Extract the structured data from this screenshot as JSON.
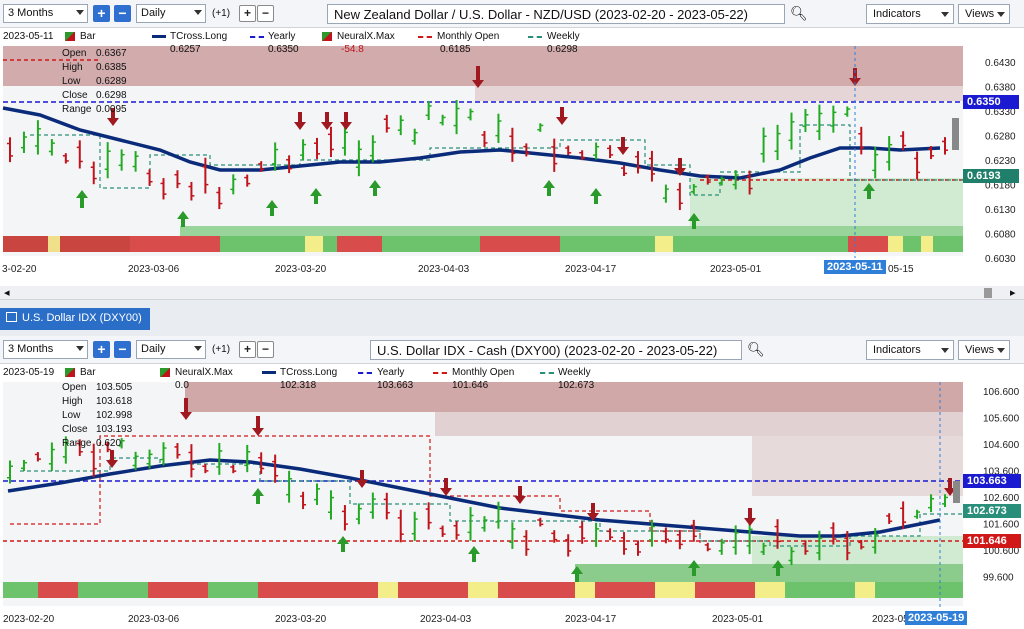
{
  "top": {
    "toolbar": {
      "range": "3 Months",
      "interval": "Daily",
      "offset": "(+1)",
      "title": "New Zealand Dollar / U.S. Dollar - NZD/USD (2023-02-20 - 2023-05-22)",
      "indicators": "Indicators",
      "views": "Views"
    },
    "legend": {
      "date": "2023-05-11",
      "bar": "Bar",
      "tcross": "TCross.Long",
      "tcross_val": "0.6257",
      "yearly": "Yearly",
      "yearly_val": "0.6350",
      "neural": "NeuralX.Max",
      "neural_val": "-54.8",
      "monthly": "Monthly Open",
      "monthly_val": "0.6185",
      "weekly": "Weekly",
      "weekly_val": "0.6298"
    },
    "ohlc": {
      "open_label": "Open",
      "open": "0.6367",
      "high_label": "High",
      "high": "0.6385",
      "low_label": "Low",
      "low": "0.6289",
      "close_label": "Close",
      "close": "0.6298",
      "range_label": "Range",
      "range": "0.0095"
    },
    "yticks": [
      "0.6430",
      "0.6380",
      "0.6330",
      "0.6280",
      "0.6230",
      "0.6180",
      "0.6130",
      "0.6080",
      "0.6030"
    ],
    "xticks": [
      "3-02-20",
      "2023-03-06",
      "2023-03-20",
      "2023-04-03",
      "2023-04-17",
      "2023-05-01",
      "05-15"
    ],
    "cursor_date": "2023-05-11",
    "badges": {
      "yearly": "0.6350",
      "monthly": "0.6193"
    }
  },
  "tab": {
    "label": "U.S. Dollar IDX (DXY00)"
  },
  "bottom": {
    "toolbar": {
      "range": "3 Months",
      "interval": "Daily",
      "offset": "(+1)",
      "title": "U.S. Dollar IDX - Cash (DXY00) (2023-02-20 - 2023-05-22)",
      "indicators": "Indicators",
      "views": "Views"
    },
    "legend": {
      "date": "2023-05-19",
      "bar": "Bar",
      "neural": "NeuralX.Max",
      "neural_val": "0.0",
      "tcross": "TCross.Long",
      "tcross_val": "102.318",
      "yearly": "Yearly",
      "yearly_val": "103.663",
      "monthly": "Monthly Open",
      "monthly_val": "101.646",
      "weekly": "Weekly",
      "weekly_val": "102.673"
    },
    "ohlc": {
      "open_label": "Open",
      "open": "103.505",
      "high_label": "High",
      "high": "103.618",
      "low_label": "Low",
      "low": "102.998",
      "close_label": "Close",
      "close": "103.193",
      "range_label": "Range",
      "range": "0.620"
    },
    "yticks": [
      "106.600",
      "105.600",
      "104.600",
      "103.600",
      "102.600",
      "101.600",
      "100.600",
      "99.600"
    ],
    "xticks": [
      "2023-02-20",
      "2023-03-06",
      "2023-03-20",
      "2023-04-03",
      "2023-04-17",
      "2023-05-01",
      "2023-05-"
    ],
    "cursor_date": "2023-05-19",
    "badges": {
      "yearly": "103.663",
      "weekly": "102.673",
      "monthly": "101.646"
    }
  },
  "colors": {
    "up": "#22aa22",
    "down": "#c0141c",
    "tcross": "#0a2a7a",
    "yearly": "#1a1ad0",
    "monthly": "#d01818",
    "weekly": "#2a8f7a",
    "accent": "#2e6fd0"
  }
}
